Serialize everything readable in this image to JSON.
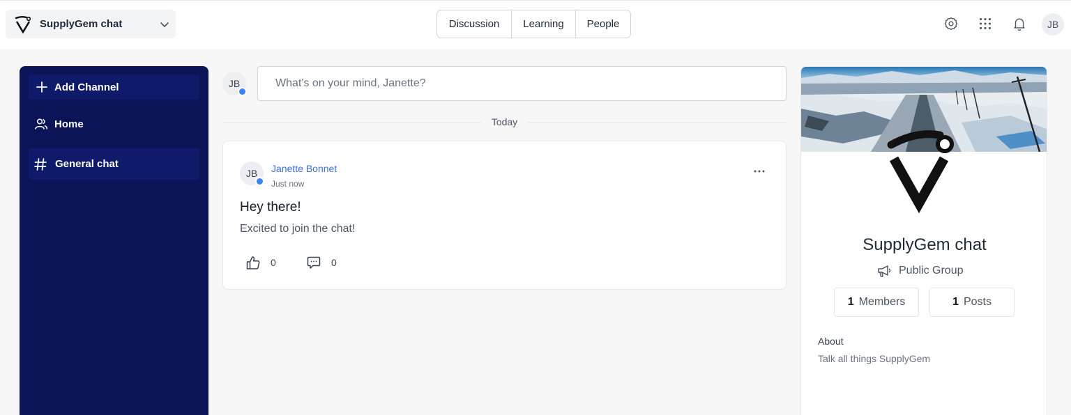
{
  "community": {
    "name": "SupplyGem chat"
  },
  "tabs": [
    {
      "label": "Discussion"
    },
    {
      "label": "Learning"
    },
    {
      "label": "People"
    }
  ],
  "user": {
    "initials": "JB",
    "first_name": "Janette"
  },
  "sidebar": {
    "items": [
      {
        "label": "Add Channel",
        "icon": "plus-icon"
      },
      {
        "label": "Home",
        "icon": "users-icon"
      },
      {
        "label": "General chat",
        "icon": "hash-icon",
        "active": true
      }
    ]
  },
  "composer": {
    "placeholder": "What's on your mind, Janette?"
  },
  "feed": {
    "divider_label": "Today",
    "posts": [
      {
        "author_initials": "JB",
        "author": "Janette Bonnet",
        "time": "Just now",
        "title": "Hey there!",
        "body": "Excited to join the chat!",
        "likes": "0",
        "comments": "0"
      }
    ]
  },
  "group": {
    "name": "SupplyGem chat",
    "type": "Public Group",
    "members_count": "1",
    "members_label": "Members",
    "posts_count": "1",
    "posts_label": "Posts",
    "about_heading": "About",
    "about_text": "Talk all things SupplyGem"
  },
  "colors": {
    "sidebar_bg": "#0b1456",
    "sidebar_active": "#0f1b6a",
    "link": "#3b6fd8",
    "badge": "#3b82f6"
  }
}
